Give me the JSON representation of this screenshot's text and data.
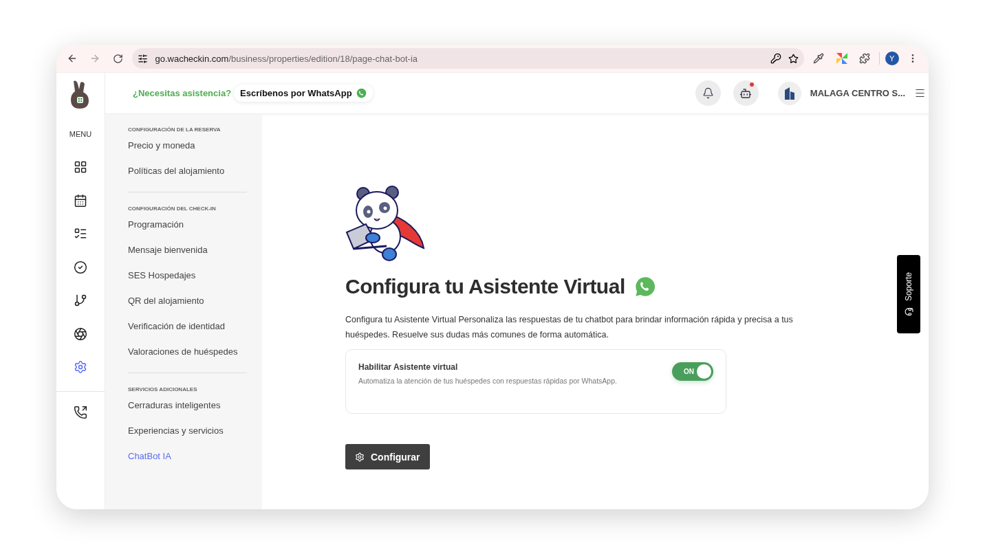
{
  "browser": {
    "url_host": "go.wacheckin.com",
    "url_path": "/business/properties/edition/18/page-chat-bot-ia",
    "profile_letter": "Y"
  },
  "header": {
    "help_label": "¿Necesitas asistencia?",
    "whatsapp_button": "Escríbenos por WhatsApp",
    "bot_badge": true,
    "property_name": "MALAGA CENTRO S..."
  },
  "rail": {
    "menu_label": "MENU",
    "items": [
      {
        "kind": "grid",
        "selected": false
      },
      {
        "kind": "calendar",
        "selected": false
      },
      {
        "kind": "list",
        "selected": false
      },
      {
        "kind": "check",
        "selected": false
      },
      {
        "kind": "branch",
        "selected": false
      },
      {
        "kind": "aperture",
        "selected": false
      },
      {
        "kind": "settings",
        "selected": true
      }
    ],
    "bottom_items": [
      {
        "kind": "phone",
        "selected": false
      }
    ]
  },
  "submenu": [
    {
      "title": "CONFIGURACIÓN DE LA RESERVA",
      "items": [
        {
          "label": "Precio y moneda",
          "selected": false
        },
        {
          "label": "Políticas del alojamiento",
          "selected": false
        }
      ]
    },
    {
      "title": "CONFIGURACIÓN DEL CHECK-IN",
      "items": [
        {
          "label": "Programación",
          "selected": false
        },
        {
          "label": "Mensaje bienvenida",
          "selected": false
        },
        {
          "label": "SES Hospedajes",
          "selected": false
        },
        {
          "label": "QR del alojamiento",
          "selected": false
        },
        {
          "label": "Verificación de identidad",
          "selected": false
        },
        {
          "label": "Valoraciones de huéspedes",
          "selected": false
        }
      ]
    },
    {
      "title": "SERVICIOS ADICIONALES",
      "items": [
        {
          "label": "Cerraduras inteligentes",
          "selected": false
        },
        {
          "label": "Experiencias y servicios",
          "selected": false
        },
        {
          "label": "ChatBot IA",
          "selected": true
        }
      ]
    }
  ],
  "main": {
    "title": "Configura tu Asistente Virtual",
    "description": "Configura tu Asistente Virtual Personaliza las respuestas de tu chatbot para brindar información rápida y precisa a tus huéspedes. Resuelve sus dudas más comunes de forma automática.",
    "card": {
      "title": "Habilitar Asistente virtual",
      "subtitle": "Automatiza la atención de tus huéspedes con respuestas rápidas por WhatsApp.",
      "toggle": {
        "on": true,
        "label": "ON"
      }
    },
    "configure_button": "Configurar"
  },
  "support_tab": "Soporte"
}
